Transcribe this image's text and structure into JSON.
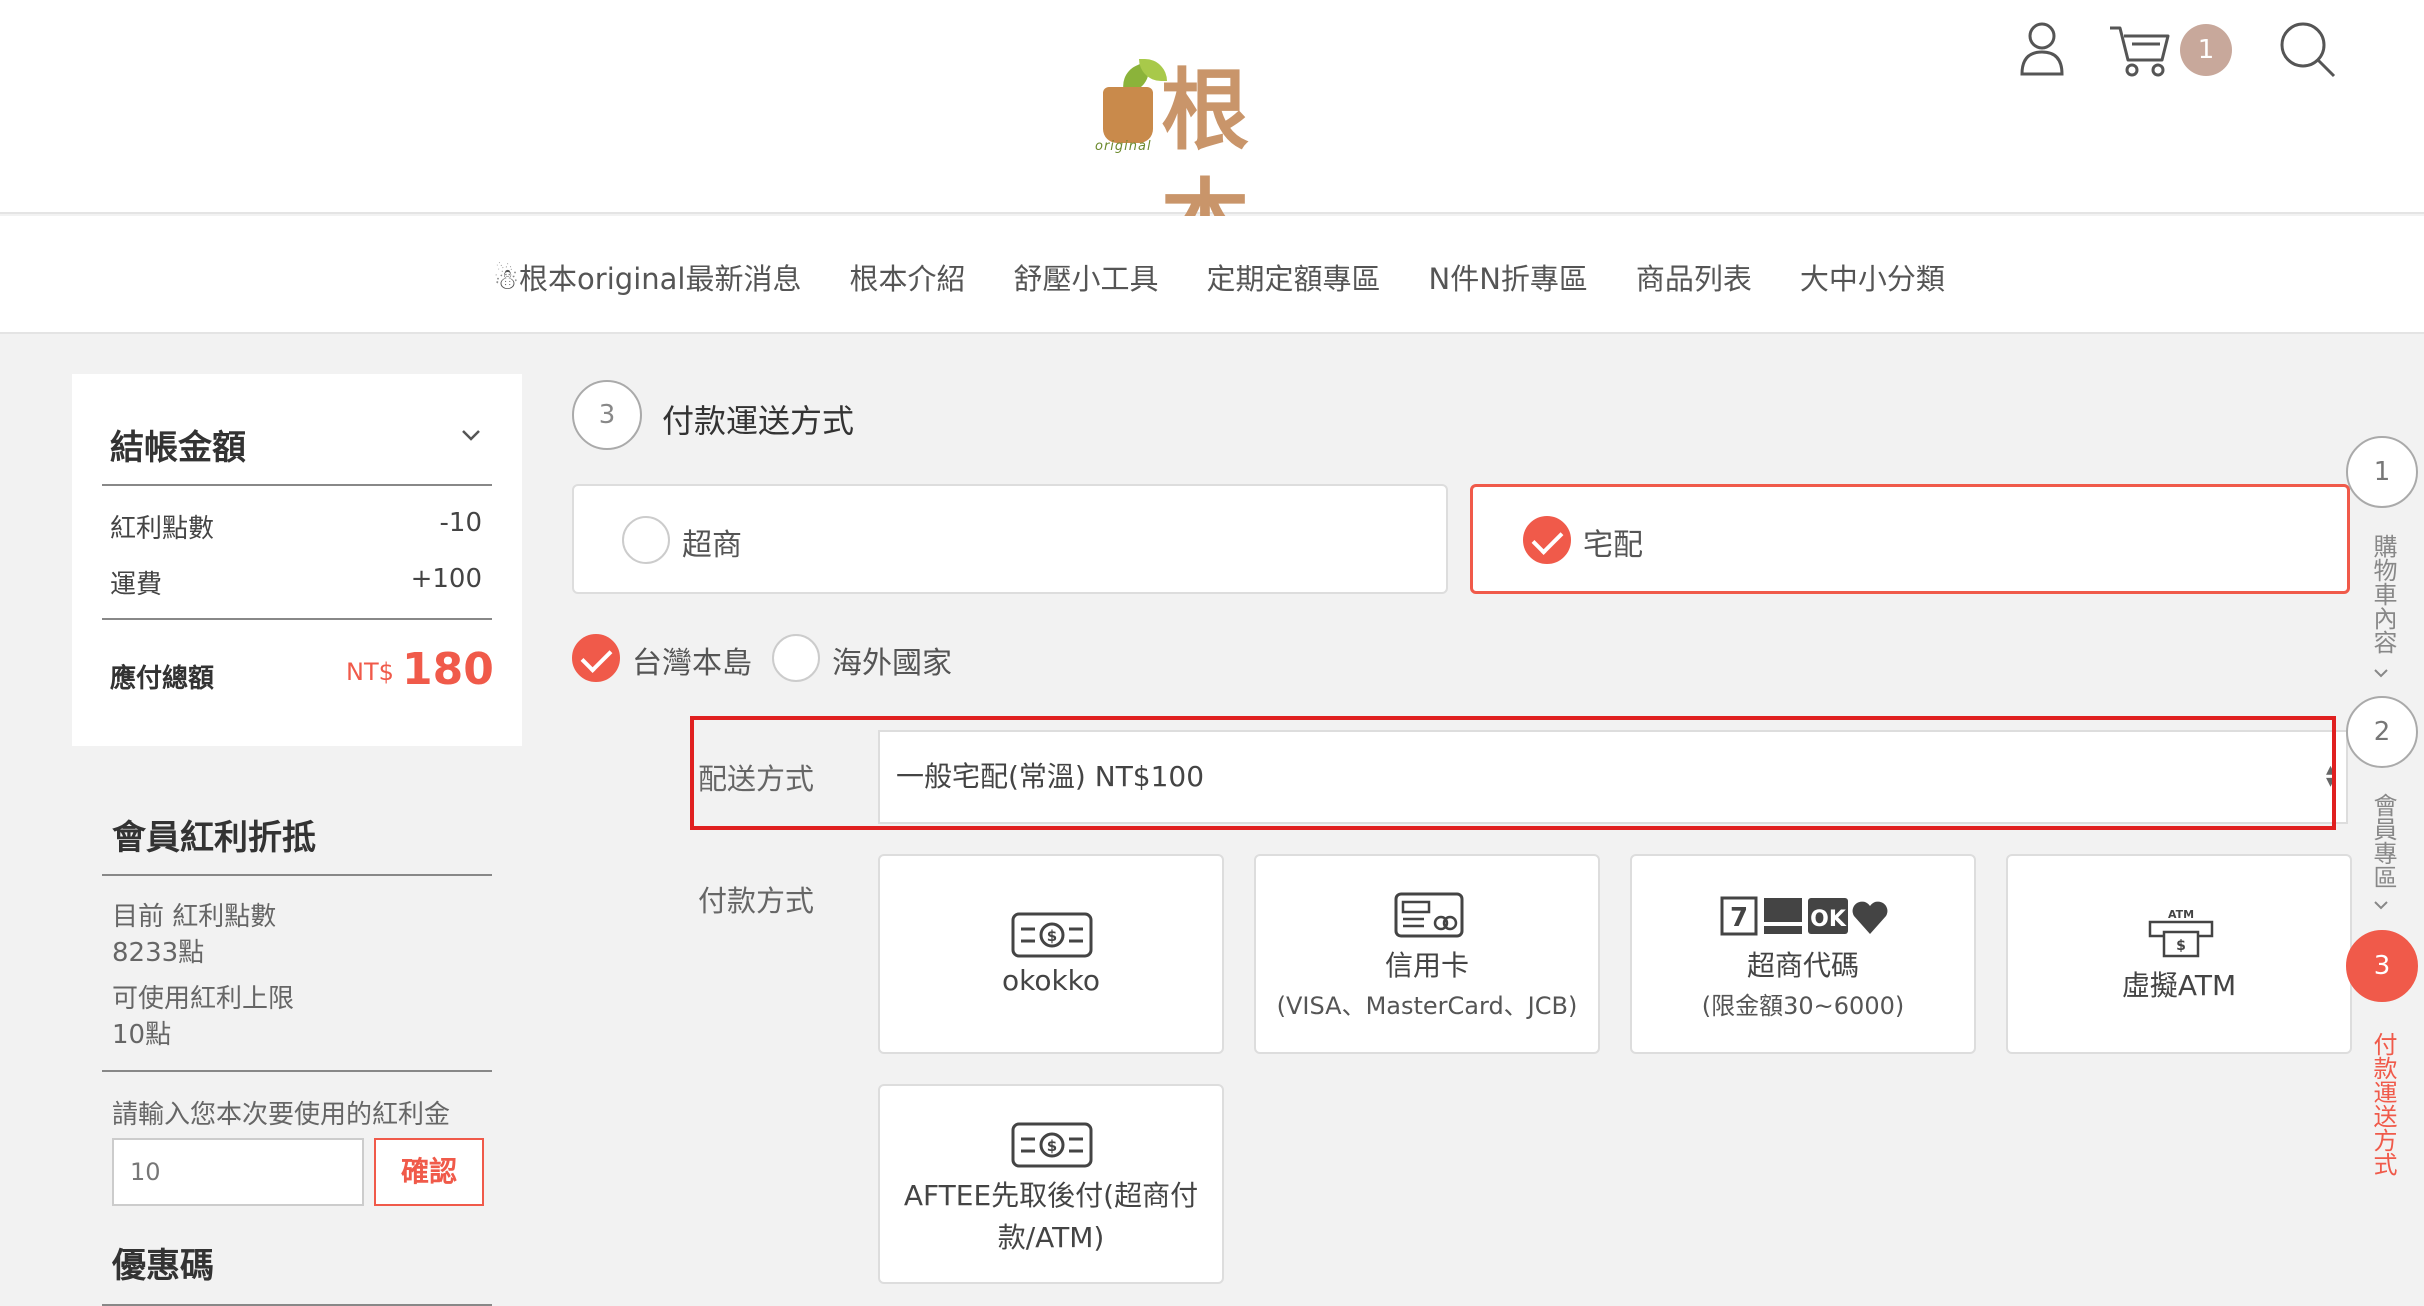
{
  "header": {
    "logo_small_text": "original",
    "logo_brand": "根本",
    "cart_count": "1"
  },
  "nav": {
    "items": [
      "☃根本original最新消息",
      "根本介紹",
      "舒壓小工具",
      "定期定額專區",
      "N件N折專區",
      "商品列表",
      "大中小分類"
    ]
  },
  "summary": {
    "title": "結帳金額",
    "rows": [
      {
        "label": "紅利點數",
        "value": "-10"
      },
      {
        "label": "運費",
        "value": "+100"
      }
    ],
    "total_label": "應付總額",
    "total_currency": "NT$",
    "total_value": "180"
  },
  "bonus": {
    "title": "會員紅利折抵",
    "current_label": "目前 紅利點數",
    "current_value": "8233點",
    "limit_label": "可使用紅利上限",
    "limit_value": "10點",
    "input_prompt": "請輸入您本次要使用的紅利金",
    "input_value": "10",
    "confirm_label": "確認",
    "coupon_title": "優惠碼"
  },
  "step3": {
    "number": "3",
    "title": "付款運送方式",
    "delivery_options": [
      {
        "label": "超商",
        "selected": false
      },
      {
        "label": "宅配",
        "selected": true
      }
    ],
    "regions": [
      {
        "label": "台灣本島",
        "selected": true
      },
      {
        "label": "海外國家",
        "selected": false
      }
    ],
    "shipping_label": "配送方式",
    "shipping_value": "一般宅配(常溫) NT$100",
    "payment_label": "付款方式",
    "payment_methods": [
      {
        "label": "okokko",
        "sub": "",
        "icon": "cash-icon"
      },
      {
        "label": "信用卡",
        "sub": "(VISA、MasterCard、JCB)",
        "icon": "credit-card-icon"
      },
      {
        "label": "超商代碼",
        "sub": "(限金額30~6000)",
        "icon": "convenience-store-logos-icon"
      },
      {
        "label": "虛擬ATM",
        "sub": "",
        "icon": "atm-icon"
      },
      {
        "label": "AFTEE先取後付(超商付",
        "sub": "款/ATM)",
        "icon": "cash-icon"
      }
    ]
  },
  "progress": {
    "steps": [
      {
        "number": "1",
        "label": "購物車內容",
        "active": false
      },
      {
        "number": "2",
        "label": "會員專區",
        "active": false
      },
      {
        "number": "3",
        "label": "付款運送方式",
        "active": true
      }
    ]
  },
  "colors": {
    "accent": "#f05a4a",
    "highlight_box": "#e02020",
    "badge": "#c8a89b"
  }
}
